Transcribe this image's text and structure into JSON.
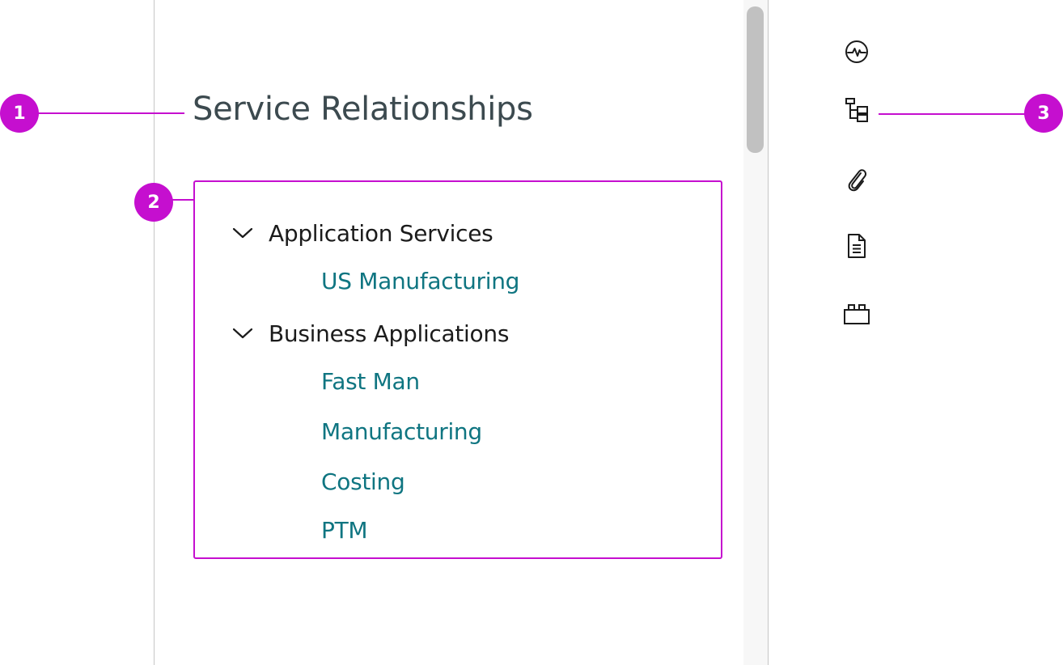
{
  "page": {
    "title": "Service Relationships"
  },
  "tree": {
    "groups": [
      {
        "label": "Application Services",
        "expanded": true,
        "items": [
          "US Manufacturing"
        ]
      },
      {
        "label": "Business Applications",
        "expanded": true,
        "items": [
          "Fast Man",
          "Manufacturing",
          "Costing",
          "PTM"
        ]
      }
    ]
  },
  "side_rail": {
    "icons": [
      "activity-icon",
      "hierarchy-icon",
      "attachment-icon",
      "document-icon",
      "modules-icon"
    ],
    "selected": "hierarchy-icon"
  },
  "callouts": {
    "markers": [
      "1",
      "2",
      "3"
    ],
    "color": "#c50fcf"
  },
  "colors": {
    "title": "#3c4a4f",
    "link": "#0f7581",
    "text": "#1b1b1b",
    "divider": "#c6c6c6"
  }
}
